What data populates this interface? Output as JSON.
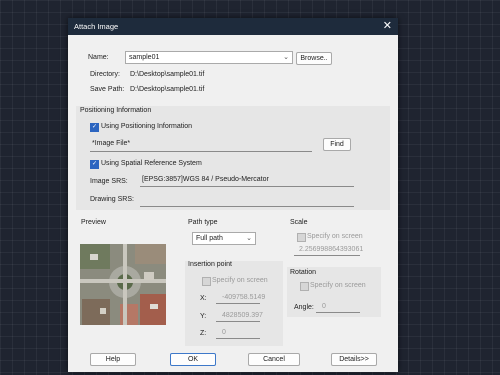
{
  "dialog": {
    "title": "Attach Image"
  },
  "name_field": {
    "label": "Name:",
    "value": "sample01"
  },
  "browse_label": "Browse..",
  "directory": {
    "label": "Directory:",
    "value": "D:\\Desktop\\sample01.tif"
  },
  "save_path": {
    "label": "Save Path:",
    "value": "D:\\Desktop\\sample01.tif"
  },
  "positioning": {
    "header": "Positioning Information",
    "use_positioning_label": "Using Positioning Information",
    "use_positioning_checked": true,
    "image_file_label": "*Image File*",
    "find_label": "Find",
    "use_srs_label": "Using Spatial Reference System",
    "use_srs_checked": true,
    "image_srs_label": "Image SRS:",
    "image_srs_value": "[EPSG:3857]WGS 84 / Pseudo-Mercator",
    "drawing_srs_label": "Drawing SRS:",
    "drawing_srs_value": ""
  },
  "preview": {
    "label": "Preview"
  },
  "path_type": {
    "label": "Path type",
    "selected": "Full path"
  },
  "scale": {
    "label": "Scale",
    "specify_label": "Specify on screen",
    "value": "2.256998864393061"
  },
  "insertion": {
    "label": "Insertion point",
    "specify_label": "Specify on screen",
    "x_label": "X:",
    "x_value": "-409758.5149",
    "y_label": "Y:",
    "y_value": "4828509.397",
    "z_label": "Z:",
    "z_value": "0"
  },
  "rotation": {
    "label": "Rotation",
    "specify_label": "Specify on screen",
    "angle_label": "Angle:",
    "angle_value": "0"
  },
  "buttons": {
    "help": "Help",
    "ok": "OK",
    "cancel": "Cancel",
    "details": "Details>>"
  },
  "icons": {
    "close": "close-icon",
    "dropdown": "chevron-down-icon",
    "check": "checkmark-icon"
  }
}
